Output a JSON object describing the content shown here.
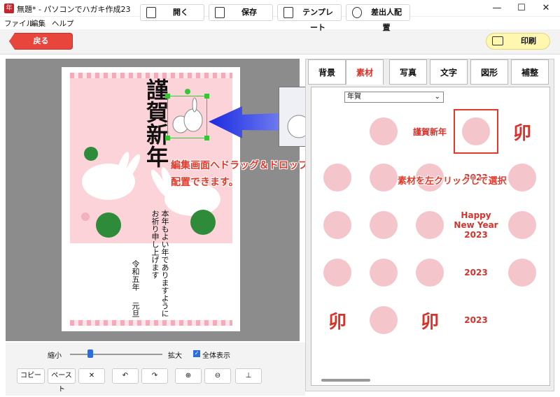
{
  "window": {
    "title": "無題* - パソコンでハガキ作成23",
    "min": "—",
    "max": "☐",
    "close": "✕"
  },
  "menu": [
    "ファイル",
    "編集",
    "ヘルプ"
  ],
  "toolbar": {
    "back": "戻る",
    "open": "開く",
    "save": "保存",
    "template": "テンプレート",
    "sender": "差出人配置",
    "print": "印刷"
  },
  "card": {
    "greeting": "謹賀新年",
    "message_col1": "本年もよい年でありますように",
    "message_col2": "お祈り申し上げます",
    "date_col1": "令和五年",
    "date_col2": "元旦"
  },
  "annotations": {
    "drag": "編集画面へドラッグ＆ドロップすると",
    "drag2": "配置できます。",
    "click": "素材を左クリックして選択"
  },
  "tabs": [
    "背景",
    "素材",
    "写真",
    "文字",
    "図形",
    "補整"
  ],
  "active_tab": "素材",
  "category": "年賀",
  "materials": [
    {
      "name": "rabbit-trio",
      "label": ""
    },
    {
      "name": "kingashinnen-stamp",
      "label": "謹賀新年"
    },
    {
      "name": "rabbit-pair",
      "label": ""
    },
    {
      "name": "u-stamp-red",
      "label": "卯"
    },
    {
      "name": "rabbit-pink",
      "label": ""
    },
    {
      "name": "rabbit-daruma",
      "label": ""
    },
    {
      "name": "rabbit-decoration",
      "label": ""
    },
    {
      "name": "rabbit-sketch",
      "label": "2023"
    },
    {
      "name": "rabbit-lying",
      "label": ""
    },
    {
      "name": "rabbit-daruma-2",
      "label": ""
    },
    {
      "name": "wreath",
      "label": ""
    },
    {
      "name": "rabbit-frame",
      "label": ""
    },
    {
      "name": "happy-new-year",
      "label": "Happy New Year 2023"
    },
    {
      "name": "rabbit-sitting",
      "label": ""
    },
    {
      "name": "rabbit-daruma-3",
      "label": ""
    },
    {
      "name": "rabbit-wreath",
      "label": ""
    },
    {
      "name": "rabbit-cloud",
      "label": ""
    },
    {
      "name": "fan-2023",
      "label": "2023"
    },
    {
      "name": "rabbit-toys",
      "label": ""
    },
    {
      "name": "u-kanji-gold",
      "label": "卯"
    },
    {
      "name": "shimenawa",
      "label": ""
    },
    {
      "name": "u-yellow",
      "label": "卯"
    },
    {
      "name": "red-circle-2023",
      "label": "2023"
    }
  ],
  "bottom": {
    "shrink": "縮小",
    "enlarge": "拡大",
    "fit": "全体表示",
    "copy": "コピー",
    "paste": "ペースト",
    "delete": "✕",
    "undo": "↶",
    "redo": "↷"
  },
  "zoom_level": 0.22,
  "colors": {
    "accent": "#e8453c",
    "selection": "#35c635",
    "print_bg": "#fff7b0"
  }
}
